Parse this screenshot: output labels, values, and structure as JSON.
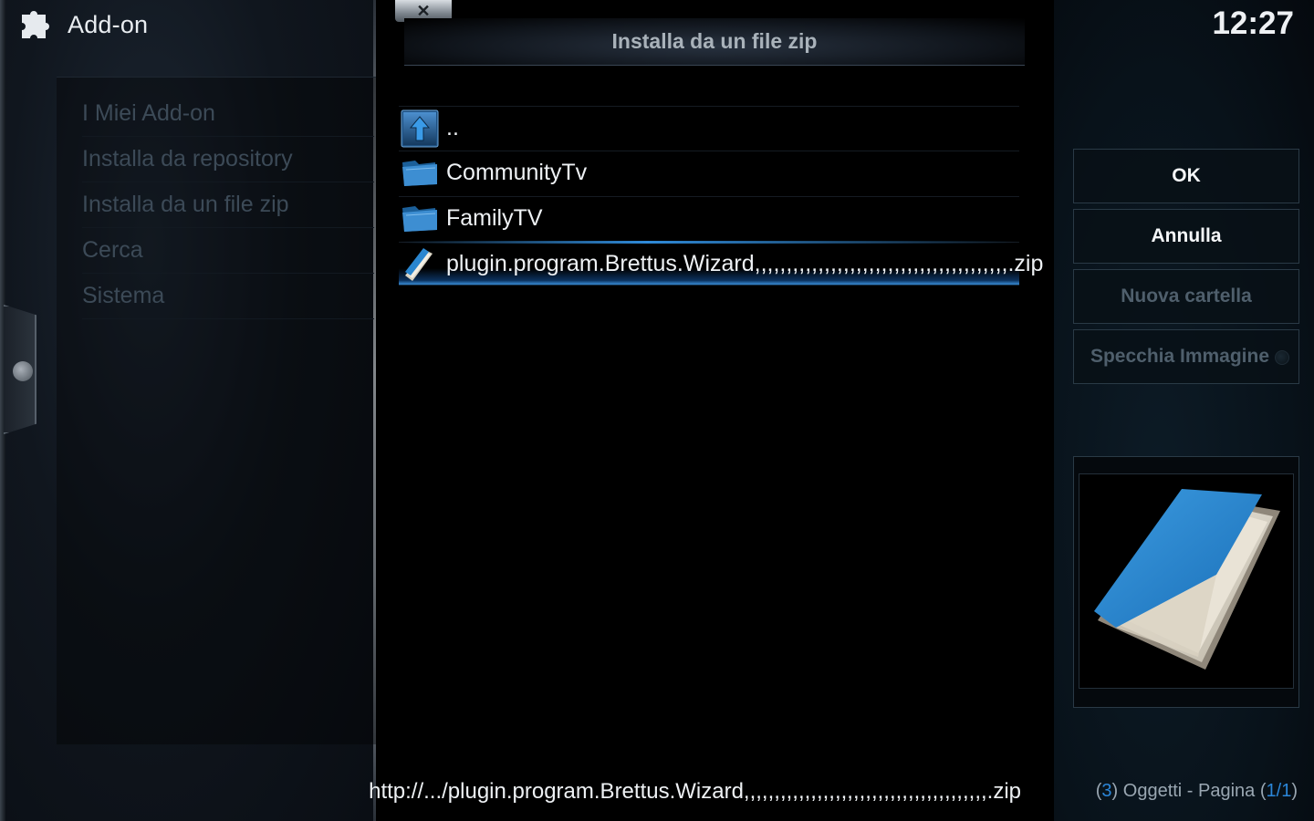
{
  "app": {
    "title": "Add-on",
    "icon": "puzzle-piece-icon"
  },
  "sidebar_menu": {
    "items": [
      {
        "label": "I Miei Add-on"
      },
      {
        "label": "Installa da repository"
      },
      {
        "label": "Installa da un file zip"
      },
      {
        "label": "Cerca"
      },
      {
        "label": "Sistema"
      }
    ]
  },
  "dialog": {
    "close_label": "✕",
    "title": "Installa da un file zip",
    "files": [
      {
        "label": "..",
        "icon": "parent-folder-up-arrow-icon"
      },
      {
        "label": "CommunityTv",
        "icon": "folder-icon"
      },
      {
        "label": "FamilyTV",
        "icon": "folder-icon"
      },
      {
        "label": "plugin.program.Brettus.Wizard,,,,,,,,,,,,,,,,,,,,,,,,,,,,,,,,,,,,,,,,.zip",
        "icon": "zip-file-icon"
      }
    ],
    "selected_index": 3,
    "path": "http://.../plugin.program.Brettus.Wizard,,,,,,,,,,,,,,,,,,,,,,,,,,,,,,,,,,,,,,,,.zip"
  },
  "clock": "12:27",
  "buttons": {
    "ok": "OK",
    "cancel": "Annulla",
    "new_folder": "Nuova cartella",
    "mirror_image": "Specchia Immagine"
  },
  "footer": {
    "count": "3",
    "items_label": "Oggetti - Pagina",
    "page": "1/1"
  },
  "colors": {
    "accent": "#2b86d8",
    "disabled_text": "#4f5f6c",
    "sidebar_text": "#3c4a57"
  }
}
